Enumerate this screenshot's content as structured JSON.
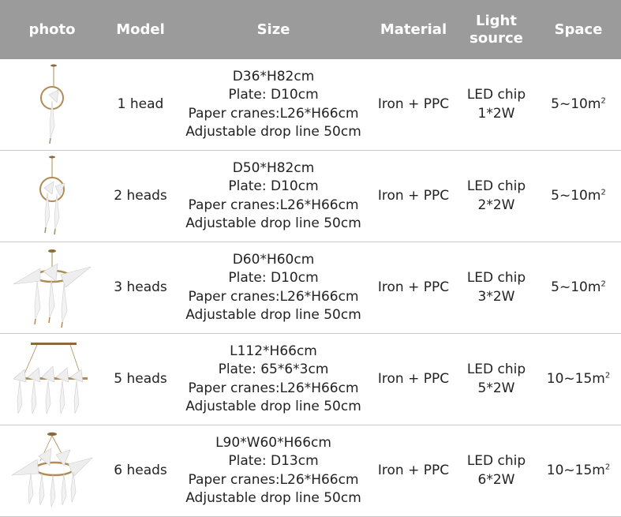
{
  "header": {
    "photo": "photo",
    "model": "Model",
    "size": "Size",
    "material": "Material",
    "light_line1": "Light",
    "light_line2": "source",
    "space": "Space"
  },
  "rows": [
    {
      "model": "1 head",
      "size": [
        "D36*H82cm",
        "Plate: D10cm",
        "Paper cranes:L26*H66cm",
        "Adjustable drop line 50cm"
      ],
      "material": "Iron + PPC",
      "light": [
        "LED chip",
        "1*2W"
      ],
      "space": "5~10m",
      "space_sup": "2"
    },
    {
      "model": "2 heads",
      "size": [
        "D50*H82cm",
        "Plate: D10cm",
        "Paper cranes:L26*H66cm",
        "Adjustable drop line 50cm"
      ],
      "material": "Iron + PPC",
      "light": [
        "LED chip",
        "2*2W"
      ],
      "space": "5~10m",
      "space_sup": "2"
    },
    {
      "model": "3 heads",
      "size": [
        "D60*H60cm",
        "Plate: D10cm",
        "Paper cranes:L26*H66cm",
        "Adjustable drop line 50cm"
      ],
      "material": "Iron + PPC",
      "light": [
        "LED chip",
        "3*2W"
      ],
      "space": "5~10m",
      "space_sup": "2"
    },
    {
      "model": "5 heads",
      "size": [
        "L112*H66cm",
        "Plate: 65*6*3cm",
        "Paper cranes:L26*H66cm",
        "Adjustable drop line 50cm"
      ],
      "material": "Iron + PPC",
      "light": [
        "LED chip",
        "5*2W"
      ],
      "space": "10~15m",
      "space_sup": "2"
    },
    {
      "model": "6 heads",
      "size": [
        "L90*W60*H66cm",
        "Plate: D13cm",
        "Paper cranes:L26*H66cm",
        "Adjustable drop line 50cm"
      ],
      "material": "Iron + PPC",
      "light": [
        "LED chip",
        "6*2W"
      ],
      "space": "10~15m",
      "space_sup": "2"
    }
  ],
  "colors": {
    "header_bg": "#9b9b9b",
    "header_text": "#ffffff",
    "text": "#222222",
    "brass": "#b08b55",
    "crane": "#eeeeee"
  }
}
